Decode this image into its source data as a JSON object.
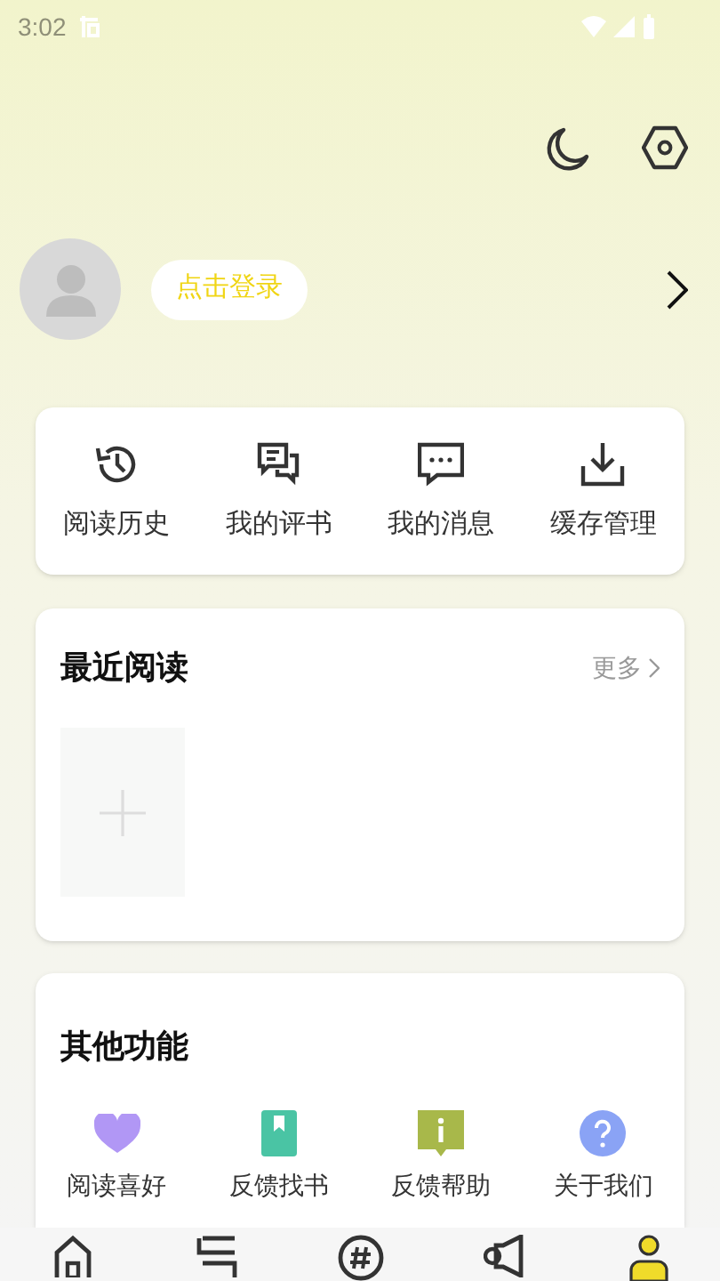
{
  "status_bar": {
    "time": "3:02"
  },
  "header": {
    "login_button": "点击登录"
  },
  "quick_actions": [
    {
      "kind": "history",
      "label": "阅读历史"
    },
    {
      "kind": "reviews",
      "label": "我的评书"
    },
    {
      "kind": "messages",
      "label": "我的消息"
    },
    {
      "kind": "download",
      "label": "缓存管理"
    }
  ],
  "recent_reading": {
    "title": "最近阅读",
    "more": "更多"
  },
  "other_functions": {
    "title": "其他功能",
    "items": [
      {
        "kind": "heart",
        "label": "阅读喜好"
      },
      {
        "kind": "book",
        "label": "反馈找书"
      },
      {
        "kind": "info",
        "label": "反馈帮助"
      },
      {
        "kind": "question",
        "label": "关于我们"
      }
    ]
  },
  "bottom_nav": [
    {
      "kind": "home",
      "selected": false
    },
    {
      "kind": "list",
      "selected": false
    },
    {
      "kind": "hashtag",
      "selected": false
    },
    {
      "kind": "megaphone",
      "selected": false
    },
    {
      "kind": "person",
      "selected": true
    }
  ]
}
